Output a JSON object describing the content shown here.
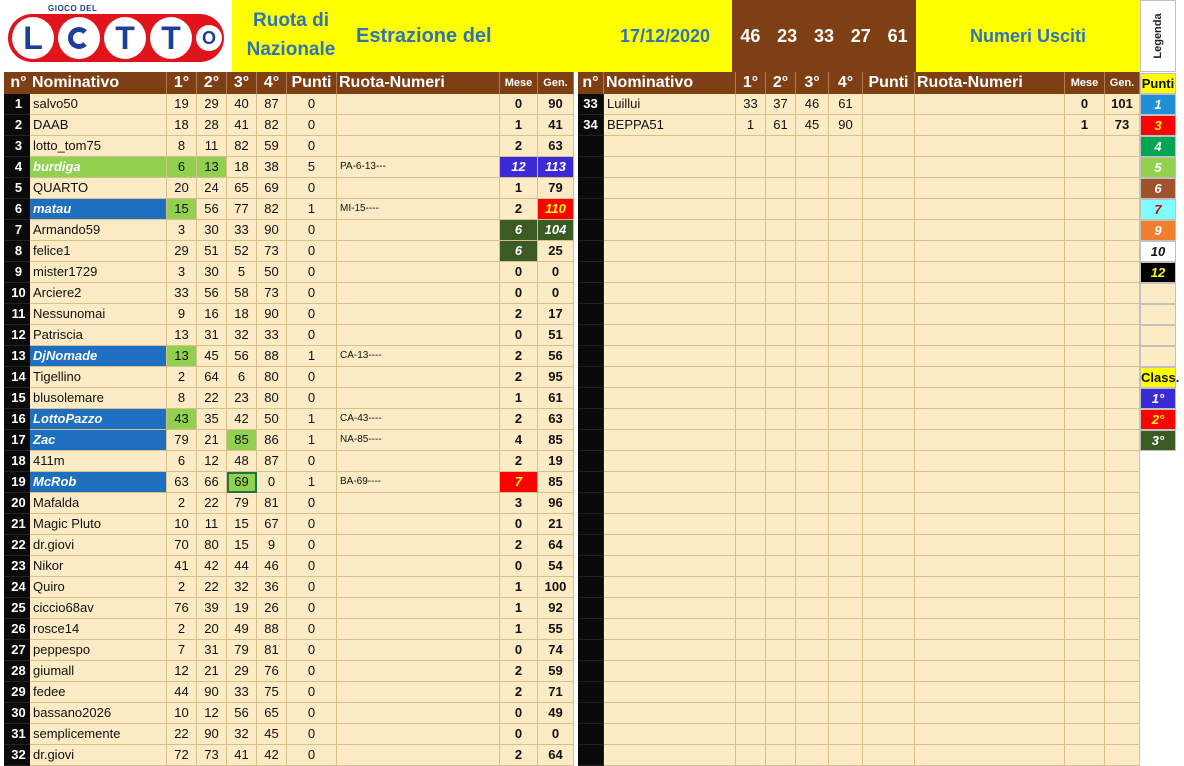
{
  "header": {
    "logo_caption": "GIOCO DEL",
    "logo_letters": [
      "L",
      "T",
      "T",
      "O"
    ],
    "ruota_line1": "Ruota di",
    "ruota_line2": "Nazionale",
    "estrazione": "Estrazione del",
    "date": "17/12/2020",
    "drawn_numbers": [
      "46",
      "23",
      "33",
      "27",
      "61"
    ],
    "numeri_usciti": "Numeri Usciti",
    "legenda": "Legenda"
  },
  "columns": {
    "n": "n°",
    "nominativo": "Nominativo",
    "p1": "1°",
    "p2": "2°",
    "p3": "3°",
    "p4": "4°",
    "punti": "Punti",
    "ruota_numeri": "Ruota-Numeri",
    "mese": "Mese",
    "gen": "Gen."
  },
  "left_rows": [
    {
      "n": "1",
      "name": "salvo50",
      "nums": [
        "19",
        "29",
        "40",
        "87"
      ],
      "punti": "0",
      "ruota": "",
      "mese": "0",
      "gen": "90"
    },
    {
      "n": "2",
      "name": "DAAB",
      "nums": [
        "18",
        "28",
        "41",
        "82"
      ],
      "punti": "0",
      "ruota": "",
      "mese": "1",
      "gen": "41"
    },
    {
      "n": "3",
      "name": "lotto_tom75",
      "nums": [
        "8",
        "11",
        "82",
        "59"
      ],
      "punti": "0",
      "ruota": "",
      "mese": "2",
      "gen": "63"
    },
    {
      "n": "4",
      "name": "burdiga",
      "nums": [
        "6",
        "13",
        "18",
        "38"
      ],
      "punti": "5",
      "ruota": "PA-6-13---",
      "mese": "12",
      "gen": "113"
    },
    {
      "n": "5",
      "name": "QUARTO",
      "nums": [
        "20",
        "24",
        "65",
        "69"
      ],
      "punti": "0",
      "ruota": "",
      "mese": "1",
      "gen": "79"
    },
    {
      "n": "6",
      "name": "matau",
      "nums": [
        "15",
        "56",
        "77",
        "82"
      ],
      "punti": "1",
      "ruota": "MI-15----",
      "mese": "2",
      "gen": "110"
    },
    {
      "n": "7",
      "name": "Armando59",
      "nums": [
        "3",
        "30",
        "33",
        "90"
      ],
      "punti": "0",
      "ruota": "",
      "mese": "6",
      "gen": "104"
    },
    {
      "n": "8",
      "name": "felice1",
      "nums": [
        "29",
        "51",
        "52",
        "73"
      ],
      "punti": "0",
      "ruota": "",
      "mese": "6",
      "gen": "25"
    },
    {
      "n": "9",
      "name": "mister1729",
      "nums": [
        "3",
        "30",
        "5",
        "50"
      ],
      "punti": "0",
      "ruota": "",
      "mese": "0",
      "gen": "0"
    },
    {
      "n": "10",
      "name": "Arciere2",
      "nums": [
        "33",
        "56",
        "58",
        "73"
      ],
      "punti": "0",
      "ruota": "",
      "mese": "0",
      "gen": "0"
    },
    {
      "n": "11",
      "name": "Nessunomai",
      "nums": [
        "9",
        "16",
        "18",
        "90"
      ],
      "punti": "0",
      "ruota": "",
      "mese": "2",
      "gen": "17"
    },
    {
      "n": "12",
      "name": "Patriscia",
      "nums": [
        "13",
        "31",
        "32",
        "33"
      ],
      "punti": "0",
      "ruota": "",
      "mese": "0",
      "gen": "51"
    },
    {
      "n": "13",
      "name": "DjNomade",
      "nums": [
        "13",
        "45",
        "56",
        "88"
      ],
      "punti": "1",
      "ruota": "CA-13----",
      "mese": "2",
      "gen": "56"
    },
    {
      "n": "14",
      "name": "Tigellino",
      "nums": [
        "2",
        "64",
        "6",
        "80"
      ],
      "punti": "0",
      "ruota": "",
      "mese": "2",
      "gen": "95"
    },
    {
      "n": "15",
      "name": "blusolemare",
      "nums": [
        "8",
        "22",
        "23",
        "80"
      ],
      "punti": "0",
      "ruota": "",
      "mese": "1",
      "gen": "61"
    },
    {
      "n": "16",
      "name": "LottoPazzo",
      "nums": [
        "43",
        "35",
        "42",
        "50"
      ],
      "punti": "1",
      "ruota": "CA-43----",
      "mese": "2",
      "gen": "63"
    },
    {
      "n": "17",
      "name": "Zac",
      "nums": [
        "79",
        "21",
        "85",
        "86"
      ],
      "punti": "1",
      "ruota": "NA-85----",
      "mese": "4",
      "gen": "85"
    },
    {
      "n": "18",
      "name": "411m",
      "nums": [
        "6",
        "12",
        "48",
        "87"
      ],
      "punti": "0",
      "ruota": "",
      "mese": "2",
      "gen": "19"
    },
    {
      "n": "19",
      "name": "McRob",
      "nums": [
        "63",
        "66",
        "69",
        "0"
      ],
      "punti": "1",
      "ruota": "BA-69----",
      "mese": "7",
      "gen": "85"
    },
    {
      "n": "20",
      "name": "Mafalda",
      "nums": [
        "2",
        "22",
        "79",
        "81"
      ],
      "punti": "0",
      "ruota": "",
      "mese": "3",
      "gen": "96"
    },
    {
      "n": "21",
      "name": "Magic Pluto",
      "nums": [
        "10",
        "11",
        "15",
        "67"
      ],
      "punti": "0",
      "ruota": "",
      "mese": "0",
      "gen": "21"
    },
    {
      "n": "22",
      "name": "dr.giovi",
      "nums": [
        "70",
        "80",
        "15",
        "9"
      ],
      "punti": "0",
      "ruota": "",
      "mese": "2",
      "gen": "64"
    },
    {
      "n": "23",
      "name": "Nikor",
      "nums": [
        "41",
        "42",
        "44",
        "46"
      ],
      "punti": "0",
      "ruota": "",
      "mese": "0",
      "gen": "54"
    },
    {
      "n": "24",
      "name": "Quiro",
      "nums": [
        "2",
        "22",
        "32",
        "36"
      ],
      "punti": "0",
      "ruota": "",
      "mese": "1",
      "gen": "100"
    },
    {
      "n": "25",
      "name": "ciccio68av",
      "nums": [
        "76",
        "39",
        "19",
        "26"
      ],
      "punti": "0",
      "ruota": "",
      "mese": "1",
      "gen": "92"
    },
    {
      "n": "26",
      "name": "rosce14",
      "nums": [
        "2",
        "20",
        "49",
        "88"
      ],
      "punti": "0",
      "ruota": "",
      "mese": "1",
      "gen": "55"
    },
    {
      "n": "27",
      "name": "peppespo",
      "nums": [
        "7",
        "31",
        "79",
        "81"
      ],
      "punti": "0",
      "ruota": "",
      "mese": "0",
      "gen": "74"
    },
    {
      "n": "28",
      "name": "giumall",
      "nums": [
        "12",
        "21",
        "29",
        "76"
      ],
      "punti": "0",
      "ruota": "",
      "mese": "2",
      "gen": "59"
    },
    {
      "n": "29",
      "name": "fedee",
      "nums": [
        "44",
        "90",
        "33",
        "75"
      ],
      "punti": "0",
      "ruota": "",
      "mese": "2",
      "gen": "71"
    },
    {
      "n": "30",
      "name": "bassano2026",
      "nums": [
        "10",
        "12",
        "56",
        "65"
      ],
      "punti": "0",
      "ruota": "",
      "mese": "0",
      "gen": "49"
    },
    {
      "n": "31",
      "name": "semplicemente",
      "nums": [
        "22",
        "90",
        "32",
        "45"
      ],
      "punti": "0",
      "ruota": "",
      "mese": "0",
      "gen": "0"
    },
    {
      "n": "32",
      "name": "dr.giovi",
      "nums": [
        "72",
        "73",
        "41",
        "42"
      ],
      "punti": "0",
      "ruota": "",
      "mese": "2",
      "gen": "64"
    }
  ],
  "right_rows": [
    {
      "n": "33",
      "name": "Luillui",
      "nums": [
        "33",
        "37",
        "46",
        "61"
      ],
      "punti": "",
      "ruota": "",
      "mese": "0",
      "gen": "101"
    },
    {
      "n": "34",
      "name": "BEPPA51",
      "nums": [
        "1",
        "61",
        "45",
        "90"
      ],
      "punti": "",
      "ruota": "",
      "mese": "1",
      "gen": "73"
    }
  ],
  "legend": {
    "punti_title": "Punti",
    "punti": [
      {
        "label": "1",
        "bg": "#1f8fd6",
        "fg": "#ffffff"
      },
      {
        "label": "3",
        "bg": "#ff0000",
        "fg": "#ffff00"
      },
      {
        "label": "4",
        "bg": "#00a651",
        "fg": "#ffffff"
      },
      {
        "label": "5",
        "bg": "#92d050",
        "fg": "#ffffff"
      },
      {
        "label": "6",
        "bg": "#a0522d",
        "fg": "#ffffff"
      },
      {
        "label": "7",
        "bg": "#7fffff",
        "fg": "#cc0000"
      },
      {
        "label": "9",
        "bg": "#f08030",
        "fg": "#ffffff"
      },
      {
        "label": "10",
        "bg": "#ffffff",
        "fg": "#111111"
      },
      {
        "label": "12",
        "bg": "#000000",
        "fg": "#ffff00"
      }
    ],
    "class_title": "Class.",
    "class": [
      {
        "label": "1°",
        "bg": "#3b2bd6",
        "fg": "#ffffff"
      },
      {
        "label": "2°",
        "bg": "#ff0000",
        "fg": "#ffff00"
      },
      {
        "label": "3°",
        "bg": "#3b5b24",
        "fg": "#ffffff"
      }
    ]
  },
  "colors": {
    "header_brown": "#7f3f14",
    "header_yellow": "#ffff00",
    "cell_bg": "#fcebc4",
    "name_highlight_blue": "#1f6fc0",
    "hit_green": "#92d050"
  }
}
